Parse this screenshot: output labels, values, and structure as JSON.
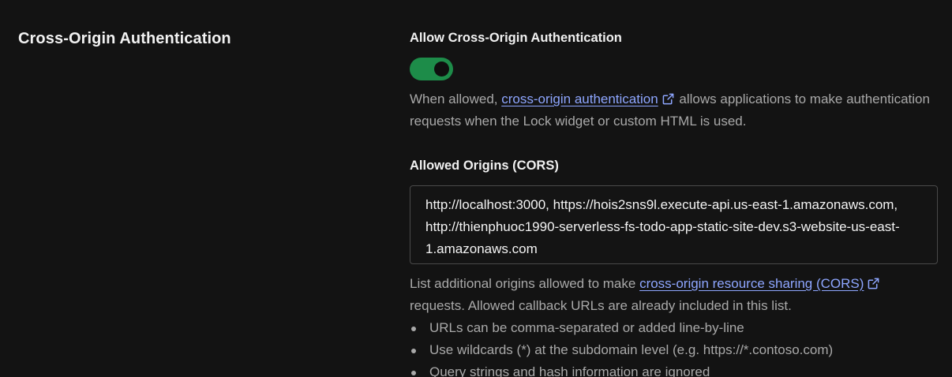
{
  "section": {
    "title": "Cross-Origin Authentication"
  },
  "allow_cross_origin": {
    "label": "Allow Cross-Origin Authentication",
    "enabled": true,
    "help_prefix": "When allowed, ",
    "help_link": "cross-origin authentication",
    "help_suffix": " allows applications to make authentication requests when the Lock widget or custom HTML is used."
  },
  "allowed_origins": {
    "label": "Allowed Origins (CORS)",
    "value": "http://localhost:3000, https://hois2sns9l.execute-api.us-east-1.amazonaws.com, http://thienphuoc1990-serverless-fs-todo-app-static-site-dev.s3-website-us-east-1.amazonaws.com",
    "help_prefix": "List additional origins allowed to make ",
    "help_link": "cross-origin resource sharing (CORS)",
    "help_suffix": " requests. Allowed callback URLs are already included in this list.",
    "tips": [
      "URLs can be comma-separated or added line-by-line",
      "Use wildcards (*) at the subdomain level (e.g. https://*.contoso.com)",
      "Query strings and hash information are ignored"
    ]
  },
  "colors": {
    "background": "#131313",
    "toggle_on": "#1d8c49",
    "link": "#8ea6ff",
    "muted_text": "#a9a9a9"
  },
  "icons": {
    "external_link": "external-link-icon"
  }
}
